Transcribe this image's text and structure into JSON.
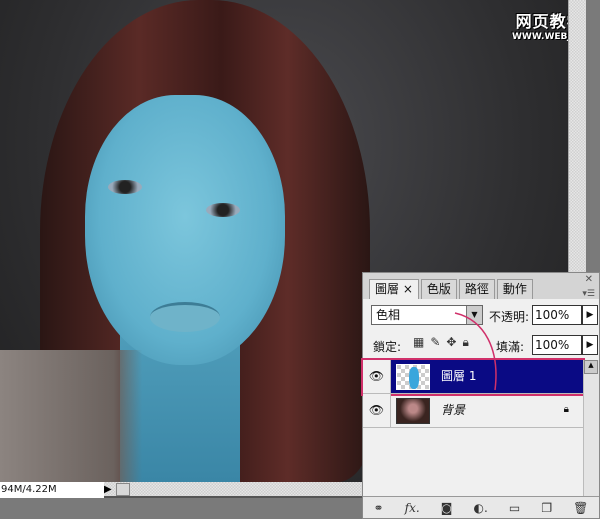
{
  "watermark": {
    "line1": "网页教学网",
    "line2": "WWW.WEBJX.COM"
  },
  "status": {
    "doc_size": "94M/4.22M"
  },
  "layers_panel": {
    "tabs": [
      {
        "label": "圖層 ×",
        "active": true
      },
      {
        "label": "色版"
      },
      {
        "label": "路徑"
      },
      {
        "label": "動作"
      }
    ],
    "blend_mode": "色相",
    "opacity_label": "不透明:",
    "opacity_value": "100%",
    "lock_label": "鎖定:",
    "fill_label": "填滿:",
    "fill_value": "100%",
    "layers": [
      {
        "name": "圖層 1",
        "selected": true
      },
      {
        "name": "背景",
        "locked": true
      }
    ]
  },
  "colors": {
    "selected_layer": "#0a0a84",
    "highlight": "#d0306a"
  }
}
